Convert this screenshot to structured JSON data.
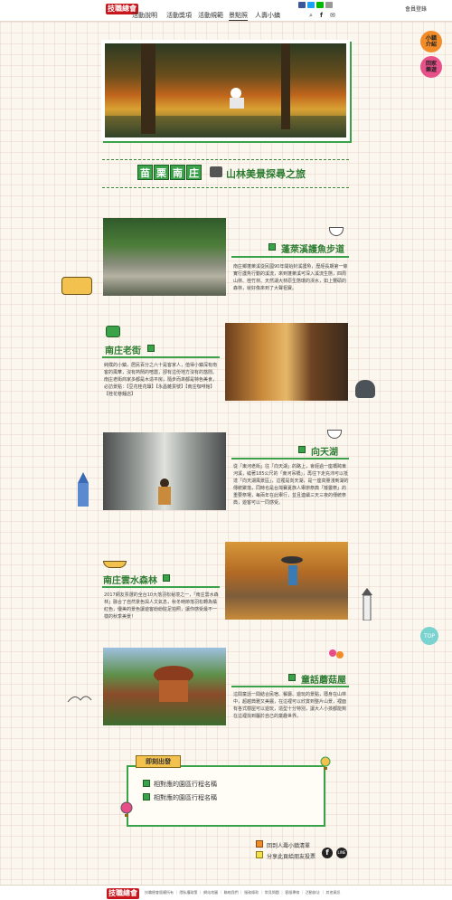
{
  "nav": {
    "logo": "技職總會",
    "items": [
      "活動說明",
      "活動獎項",
      "活動規範",
      "景點照",
      "人壽小鎮"
    ],
    "member": "會員登錄"
  },
  "side": {
    "btn1": "小鎮\n介紹",
    "btn2": "回家\n樂遊",
    "top": "TOP"
  },
  "title": {
    "chars": [
      "苗",
      "栗",
      "南",
      "庄"
    ],
    "subtitle": "山林美景探尋之旅"
  },
  "sections": [
    {
      "title": "蓬萊溪護魚步道",
      "text": "南庄鄉蓬萊溪從民國90年開始封溪護魚，歷經長期第一條實行護魚行動的溪流，來到蓬萊溪可深入溪流生態，四周山林、桂竹林、天然湖大林原生態環的渓水，如上豐碩的森林，就好像來到了大聲祖寶。"
    },
    {
      "title": "南庄老街",
      "text": "純樸的小鎮，居民百分之六十是客家人，值得小鎮深有南客的風華，沒有熱鬧的喧囂，卻有這份地方沒有的悠閒。南庄老街商家多都是木造平房，隨步而來都是特色美食，必訪景點：【豆花桂花釀】【永昌雜貨號】【南庄咖啡館】【桂花巷麵店】"
    },
    {
      "title": "向天湖",
      "text": "從「東河老街」往「向天湖」的路上，會經過一座橋跨東河溪，繞著185公尺的「東河吊橋」，再往下走充沛可以抵達「向天湖風景區」，這裡是向天湖，是一座高量淺到湖的傳統聚落，同時也是台灣賽夏族人舉辦祭典「矮靈祭」的重要祭場，每兩年在此舉行，並且連續三天三夜的傳統祭典，遊客可以一同感受。"
    },
    {
      "title": "南庄雲水森林",
      "text": "2017網友票選的全台10大落羽松秘境之一，「南庄雲水森林」融合了自然景色與人文氣息，秋冬時節落羽松轉為橘紅色，優美的景色讓遊客紛紛駐足拍照，讓你感受最不一樣的秋季美景！"
    },
    {
      "title": "童話蘑菇屋",
      "text": "這間童話一間結合民宿、餐廳、遊玩的景點，隱身在山林中，超越典雅又美麗，在這裡可以欣賞到整片山景，裡面有各式樹屋可以遊玩，造型十分特別，讓大人小孩都能夠在這裡找到屬於自己的童趣世界。"
    }
  ],
  "depart": {
    "badge": "即刻出發",
    "items": [
      "相對應的園區行程名稱",
      "相對應的園區行程名稱"
    ]
  },
  "links": [
    "回到人壽小鎮清單",
    "分享此頁給朋友投票"
  ],
  "footer": "技職總會版權所有 ｜ 隱私權政策 ｜ 網站地圖 ｜ 聯絡我們 ｜ 服務條款 ｜ 常見問題 ｜ 客服專線 ｜ 活動辦法 ｜ 其他資訊"
}
